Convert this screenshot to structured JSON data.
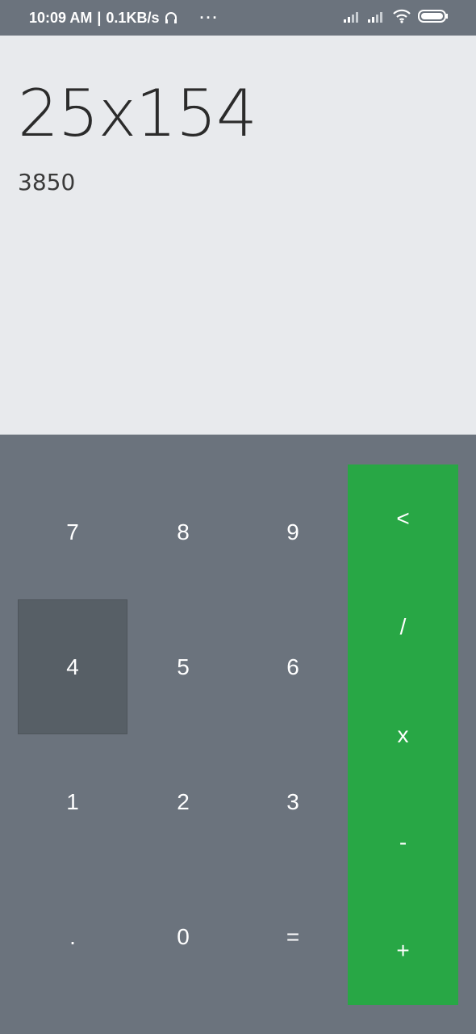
{
  "status_bar": {
    "time": "10:09 AM",
    "separator": "|",
    "speed": "0.1KB/s",
    "more": "···",
    "icons": [
      "headset-icon",
      "signal-icon",
      "signal-icon",
      "wifi-icon",
      "battery-icon"
    ]
  },
  "display": {
    "expression": "25x154",
    "result": "3850"
  },
  "keys": {
    "k7": "7",
    "k8": "8",
    "k9": "9",
    "k4": "4",
    "k5": "5",
    "k6": "6",
    "k1": "1",
    "k2": "2",
    "k3": "3",
    "dot": ".",
    "k0": "0",
    "equals": "="
  },
  "operators": {
    "backspace": "<",
    "divide": "/",
    "multiply": "x",
    "subtract": "-",
    "add": "+"
  },
  "colors": {
    "accent": "#28a745",
    "keypad_bg": "#6b737d",
    "display_bg": "#e8eaed",
    "pressed_key": "#575f66"
  }
}
